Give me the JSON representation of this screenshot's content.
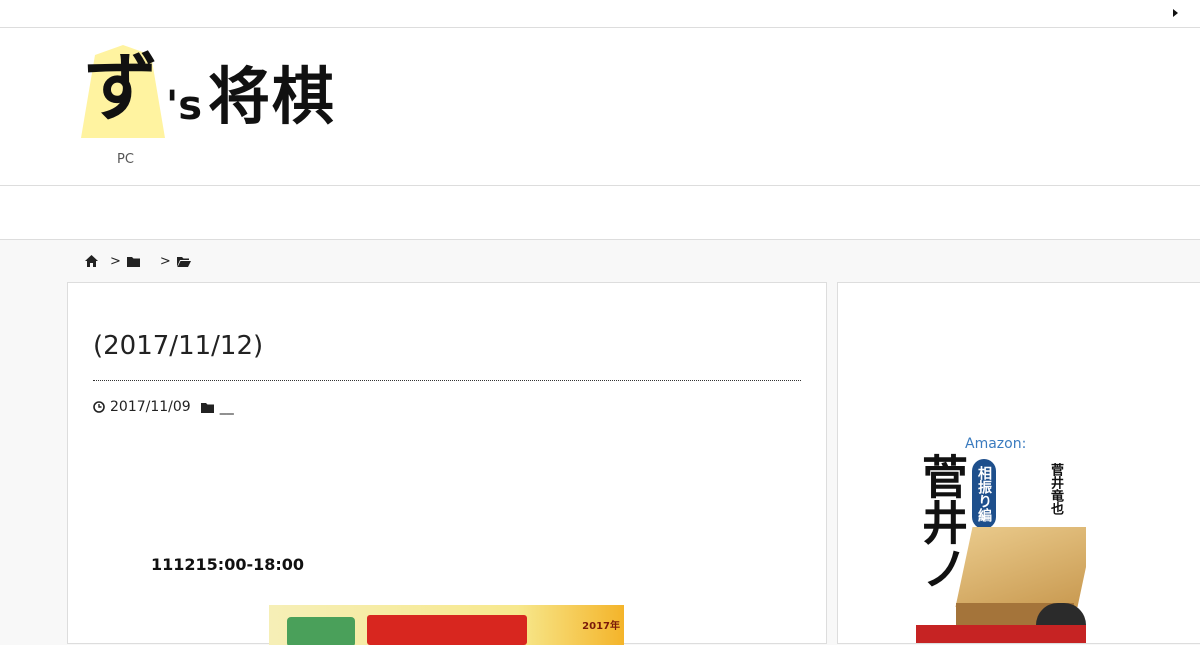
{
  "site": {
    "logo_main": "ず",
    "logo_suffix": "'s",
    "logo_name": "将棋",
    "tagline": "PC"
  },
  "breadcrumb": {
    "separator_1": ">",
    "separator_2": ">",
    "icons": [
      "home-icon",
      "folder-icon",
      "folder-open-icon"
    ]
  },
  "article": {
    "title": "(2017/11/12)",
    "date": "2017/11/09",
    "category": "__",
    "event_time": "111215:00-18:00",
    "banner_year": "2017年"
  },
  "sidebar": {
    "amazon_label": "Amazon:",
    "book": {
      "title": "菅井ノ",
      "tag": "相振り編",
      "author": "菅井竜也"
    }
  },
  "colors": {
    "link": "#3a7bbf",
    "logo_piece": "#fff3a0"
  }
}
